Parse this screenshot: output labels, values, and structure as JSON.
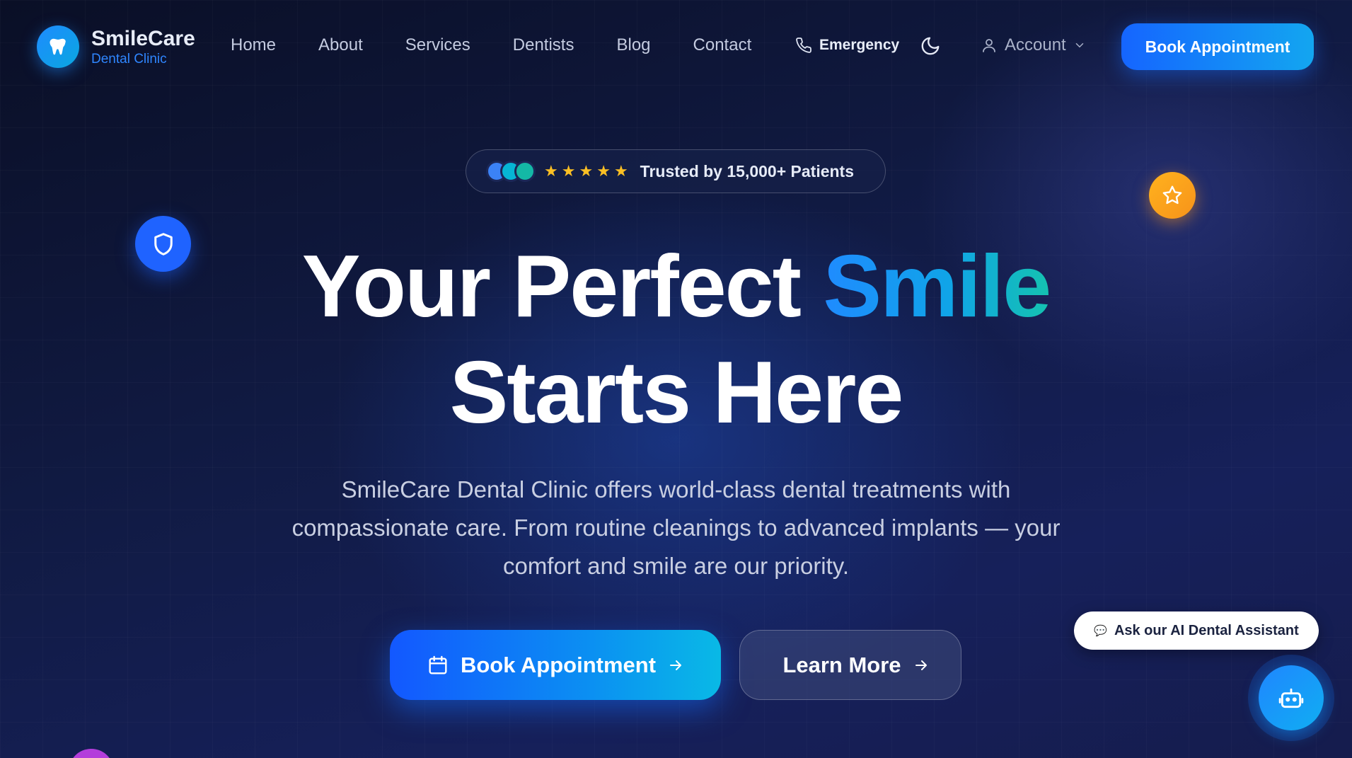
{
  "brand": {
    "name": "SmileCare",
    "subtitle": "Dental Clinic",
    "logo_icon": "tooth-icon"
  },
  "nav": {
    "links": [
      "Home",
      "About",
      "Services",
      "Dentists",
      "Blog",
      "Contact"
    ],
    "emergency_label": "Emergency",
    "theme_toggle_icon": "moon-icon",
    "account_label": "Account",
    "cta_label": "Book Appointment"
  },
  "hero": {
    "trust_text": "Trusted by 15,000+ Patients",
    "rating_stars": 5,
    "avatar_colors": [
      "#3b82f6",
      "#06b6d4",
      "#14b8a6"
    ],
    "title_line1_plain": "Your Perfect",
    "title_line1_accent": "Smile",
    "title_line2": "Starts Here",
    "description": "SmileCare Dental Clinic offers world-class dental treatments with compassionate care. From routine cleanings to advanced implants — your comfort and smile are our priority.",
    "primary_cta": "Book Appointment",
    "secondary_cta": "Learn More"
  },
  "assistant": {
    "prompt": "Ask our AI Dental Assistant",
    "icon": "robot-icon"
  },
  "colors": {
    "accent": "#1f6bff",
    "accent_cyan": "#10a4e8",
    "star": "#fbbf24",
    "background": "#0c1230"
  }
}
